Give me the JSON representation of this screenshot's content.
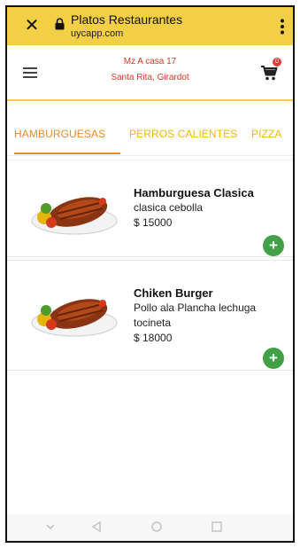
{
  "browser": {
    "title": "Platos Restaurantes",
    "url": "uycapp.com",
    "color": "#f2cf45"
  },
  "header": {
    "address_line1": "Mz A casa 17",
    "address_line2": "Santa Rita, Girardot",
    "cart_count": "0"
  },
  "tabs": [
    {
      "label": "HAMBURGUESAS",
      "active": true
    },
    {
      "label": "PERROS CALIENTES",
      "active": false
    },
    {
      "label": "PIZZA",
      "active": false
    }
  ],
  "products": [
    {
      "name": "Hamburguesa Clasica",
      "description": "clasica cebolla",
      "price": "$ 15000",
      "add_label": "+"
    },
    {
      "name": "Chiken Burger",
      "description": "Pollo ala Plancha lechuga tocineta",
      "price": "$ 18000",
      "add_label": "+"
    }
  ],
  "icons": [
    "close-icon",
    "lock-icon",
    "more-vert-icon",
    "menu-icon",
    "cart-icon",
    "add-icon",
    "back-icon",
    "home-icon",
    "recents-icon",
    "chevron-down-icon"
  ],
  "colors": {
    "accent": "#ea8a26",
    "tab": "#f2b705",
    "address": "#d63a2a",
    "add_button": "#43a047",
    "badge": "#e53935"
  }
}
